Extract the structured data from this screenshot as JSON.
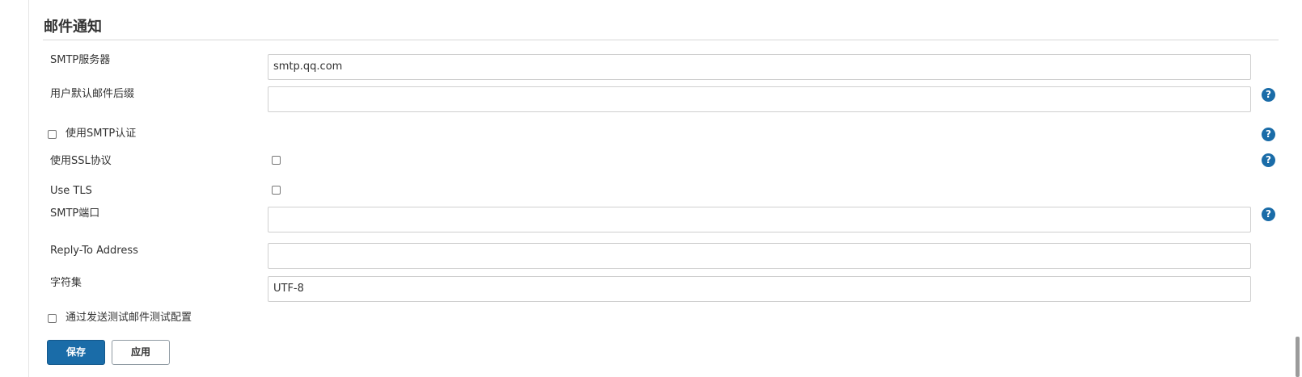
{
  "section": {
    "title": "邮件通知"
  },
  "fields": {
    "smtp_server": {
      "label": "SMTP服务器",
      "value": "smtp.qq.com"
    },
    "default_suffix": {
      "label": "用户默认邮件后缀",
      "value": ""
    },
    "smtp_auth": {
      "label": "使用SMTP认证",
      "checked": false
    },
    "use_ssl": {
      "label": "使用SSL协议",
      "checked": false
    },
    "use_tls": {
      "label": "Use TLS",
      "checked": false
    },
    "smtp_port": {
      "label": "SMTP端口",
      "value": ""
    },
    "reply_to": {
      "label": "Reply-To Address",
      "value": ""
    },
    "charset": {
      "label": "字符集",
      "value": "UTF-8"
    },
    "test_config": {
      "label": "通过发送测试邮件测试配置",
      "checked": false
    }
  },
  "help": {
    "glyph": "?"
  },
  "buttons": {
    "save": "保存",
    "apply": "应用"
  },
  "colors": {
    "primary": "#1a6ca8",
    "help": "#1a6ca8"
  }
}
